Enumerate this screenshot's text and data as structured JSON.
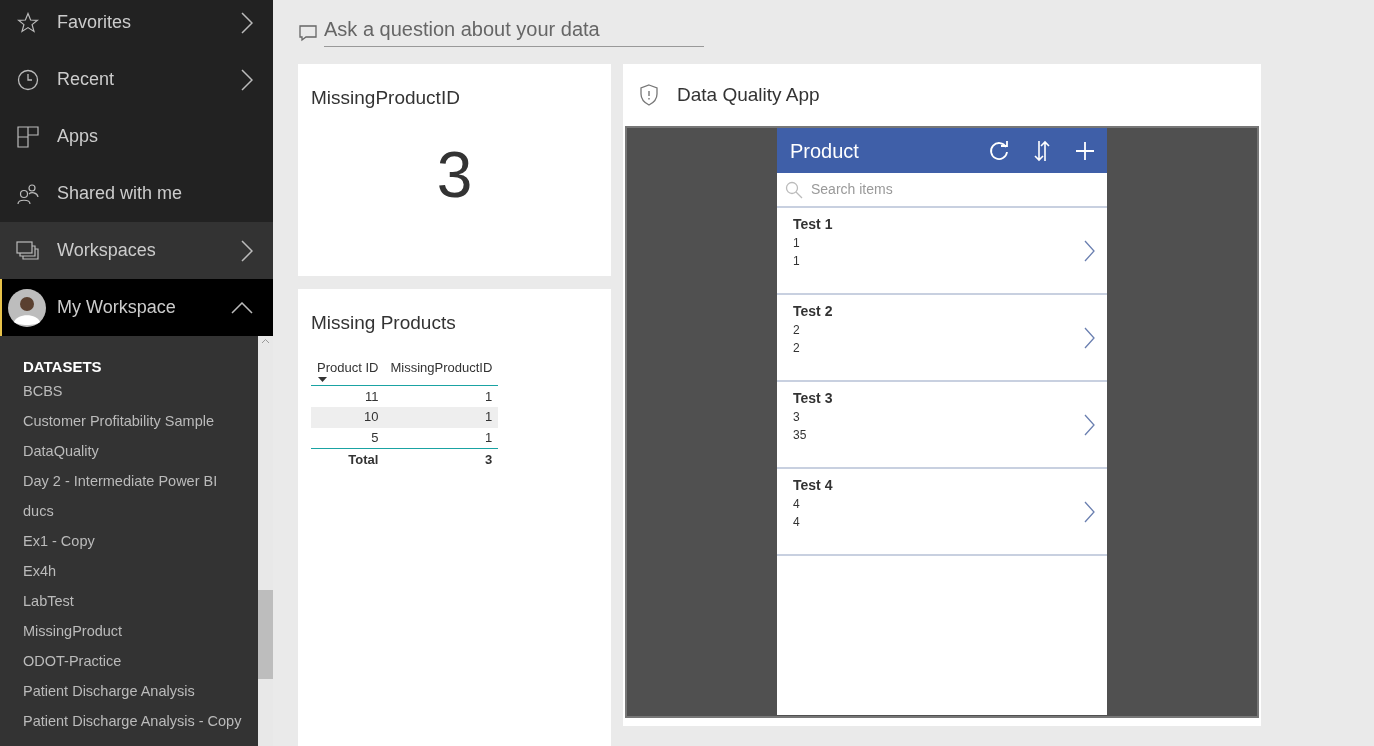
{
  "sidebar": {
    "nav": [
      {
        "label": "Favorites",
        "kind": "expandable",
        "expanded": false,
        "selected": false,
        "hovered": false
      },
      {
        "label": "Recent",
        "kind": "expandable",
        "expanded": false,
        "selected": false,
        "hovered": false
      },
      {
        "label": "Apps",
        "kind": "link",
        "selected": false,
        "hovered": false
      },
      {
        "label": "Shared with me",
        "kind": "link",
        "selected": false,
        "hovered": false
      },
      {
        "label": "Workspaces",
        "kind": "expandable",
        "expanded": false,
        "selected": false,
        "hovered": true
      },
      {
        "label": "My Workspace",
        "kind": "expandable",
        "expanded": true,
        "selected": true,
        "hovered": false
      }
    ],
    "section_title": "DATASETS",
    "datasets": [
      "BCBS",
      "Customer Profitability Sample",
      "DataQuality",
      "Day 2 - Intermediate Power BI",
      "ducs",
      "Ex1 - Copy",
      "Ex4h",
      "LabTest",
      "MissingProduct",
      "ODOT-Practice",
      "Patient Discharge Analysis",
      "Patient Discharge Analysis - Copy"
    ]
  },
  "qna": {
    "placeholder": "Ask a question about your data"
  },
  "card_tile": {
    "title": "MissingProductID",
    "value": "3"
  },
  "table_tile": {
    "title": "Missing Products",
    "columns": [
      "Product ID",
      "MissingProductID"
    ],
    "rows": [
      {
        "cells": [
          "11",
          "1"
        ],
        "shaded": false
      },
      {
        "cells": [
          "10",
          "1"
        ],
        "shaded": true
      },
      {
        "cells": [
          "5",
          "1"
        ],
        "shaded": false
      }
    ],
    "total": [
      "Total",
      "3"
    ]
  },
  "app_tile": {
    "title": "Data Quality App",
    "app": {
      "title": "Product",
      "search_placeholder": "Search items",
      "items": [
        {
          "title": "Test 1",
          "line_1": "1",
          "line_2": "1"
        },
        {
          "title": "Test 2",
          "line_1": "2",
          "line_2": "2"
        },
        {
          "title": "Test 3",
          "line_1": "3",
          "line_2": "35"
        },
        {
          "title": "Test 4",
          "line_1": "4",
          "line_2": "4"
        }
      ]
    }
  }
}
